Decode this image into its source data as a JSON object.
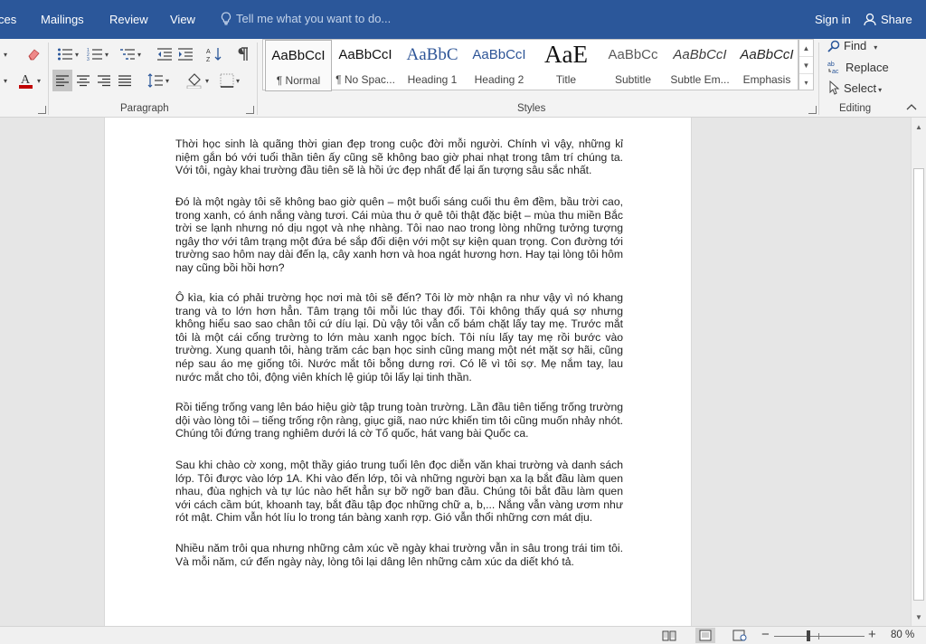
{
  "tabs": {
    "references": "ces",
    "mailings": "Mailings",
    "review": "Review",
    "view": "View"
  },
  "tellme": {
    "placeholder": "Tell me what you want to do..."
  },
  "account": {
    "signin": "Sign in",
    "share": "Share"
  },
  "groups": {
    "paragraph": "Paragraph",
    "styles": "Styles",
    "editing": "Editing"
  },
  "styles": [
    {
      "sample": "AaBbCcI",
      "name": "¶ Normal",
      "color": "#111111"
    },
    {
      "sample": "AaBbCcI",
      "name": "¶ No Spac...",
      "color": "#111111"
    },
    {
      "sample": "AaBbC",
      "name": "Heading 1",
      "color": "#2e5597"
    },
    {
      "sample": "AaBbCcI",
      "name": "Heading 2",
      "color": "#2e5597"
    },
    {
      "sample": "AaE",
      "name": "Title",
      "color": "#111111"
    },
    {
      "sample": "AaBbCc",
      "name": "Subtitle",
      "color": "#595959"
    },
    {
      "sample": "AaBbCcI",
      "name": "Subtle Em...",
      "color": "#404040"
    },
    {
      "sample": "AaBbCcI",
      "name": "Emphasis",
      "color": "#262626"
    }
  ],
  "editing": {
    "find": "Find",
    "replace": "Replace",
    "select": "Select"
  },
  "document": {
    "paragraphs": [
      "Thời học sinh là quãng thời gian đẹp trong cuộc đời mỗi người. Chính vì vậy, những kỉ niệm gắn bó với tuổi thần tiên ấy cũng sẽ không bao giờ phai nhạt trong tâm trí chúng ta. Với tôi, ngày khai trường đầu tiên sẽ là hồi ức đẹp nhất để lại ấn tượng sâu sắc nhất.",
      "Đó là một ngày tôi sẽ không bao giờ quên – một buổi sáng cuối thu êm đềm, bầu trời cao, trong xanh, có ánh nắng vàng tươi. Cái mùa thu ở quê tôi thật đặc biệt – mùa thu miền Bắc trời se lạnh nhưng nó dịu ngọt và nhẹ nhàng. Tôi nao nao trong lòng những tưởng tượng ngây thơ với tâm trạng một đứa bé sắp đối diện với một sự kiện quan trọng. Con đường tới trường sao hôm nay dài đến lạ, cây xanh hơn và hoa ngát hương hơn. Hay tại lòng tôi hôm nay cũng bồi hồi hơn?",
      "Ô kìa, kia có phải trường học nơi mà tôi sẽ đến? Tôi lờ mờ nhận ra như vậy vì nó khang trang và to lớn hơn hẳn. Tâm trạng tôi mỗi lúc thay đổi. Tôi không thấy quá sợ nhưng không hiểu sao sao chân tôi cứ díu lại. Dù vậy tôi vẫn cố bám chặt lấy tay mẹ. Trước mắt tôi là một cái cổng trường to lớn màu xanh ngọc bích. Tôi níu lấy tay mẹ rồi bước vào trường. Xung quanh tôi, hàng trăm các bạn học sinh cũng mang một nét mặt sợ hãi, cũng nép sau áo mẹ giống tôi. Nước mắt tôi bỗng dưng rơi. Có lẽ vì tôi sợ. Mẹ nắm tay, lau nước mắt cho tôi, động viên khích lệ giúp tôi lấy lại tinh thần.",
      "Rồi tiếng trống vang lên báo hiệu giờ tập trung toàn trường. Lần đầu tiên tiếng trống trường dội vào lòng tôi – tiếng trống rộn ràng, giục giã, nao nức khiến tim tôi cũng muốn nhảy nhót. Chúng tôi đứng trang nghiêm dưới lá cờ Tổ quốc, hát vang bài Quốc ca.",
      "Sau khi chào cờ xong, một thầy giáo trung tuổi lên đọc diễn văn khai trường và danh sách lớp. Tôi được vào lớp 1A. Khi vào đến lớp, tôi và những người bạn xa lạ bắt đầu làm quen nhau, đùa nghịch và tự lúc nào hết hẳn sự bỡ ngỡ ban đầu. Chúng tôi bắt đầu làm quen với cách cầm bút, khoanh tay, bắt đầu tập đọc những chữ a, b,... Nắng vẫn vàng ươm như rót mật. Chim vẫn hót líu lo trong tán bàng xanh rợp. Gió vẫn thổi những cơn mát dịu.",
      "Nhiều năm trôi qua nhưng những cảm xúc về ngày khai trường vẫn in sâu trong trái tim tôi. Và mỗi năm, cứ đến ngày này, lòng tôi lại dâng lên những cảm xúc da diết khó tả."
    ]
  },
  "status": {
    "zoom_minus": "−",
    "zoom_plus": "+",
    "zoom": "80 %",
    "zoom_fraction": 0.8
  }
}
